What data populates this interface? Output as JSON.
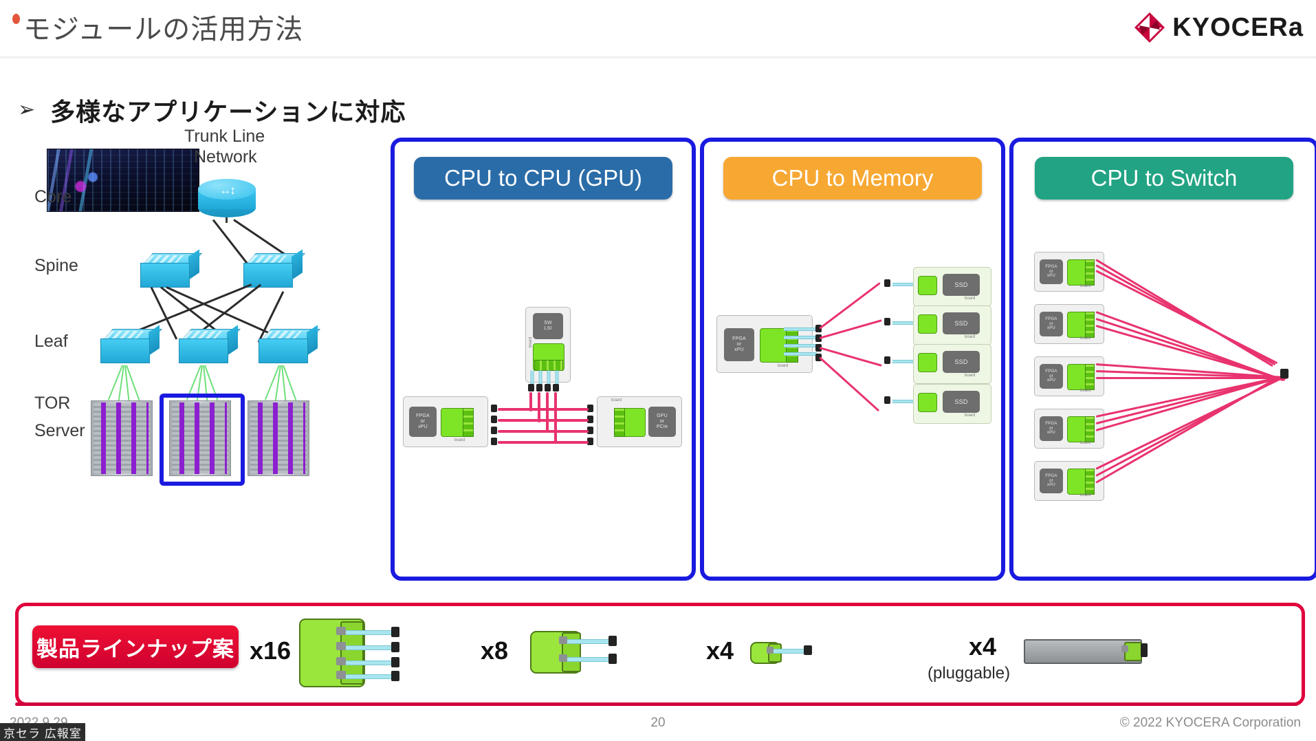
{
  "header": {
    "title": "モジュールの活用方法",
    "logo_text": "KYOCERa",
    "logo_mark_color": "#c8003c"
  },
  "bullet": {
    "marker": "➢",
    "text": "多様なアプリケーションに対応"
  },
  "network": {
    "trunk_label_line1": "Trunk Line",
    "trunk_label_line2": "Network",
    "tiers": [
      {
        "label": "Core"
      },
      {
        "label": "Spine"
      },
      {
        "label": "Leaf"
      },
      {
        "label": "TOR"
      },
      {
        "label": "Server"
      }
    ],
    "highlight_color": "#1a1ae0"
  },
  "panels": [
    {
      "id": "cpu-to-cpu",
      "title": "CPU to CPU (GPU)",
      "header_color": "#2a6ca8",
      "border_color": "#1a1ae0",
      "devices": [
        {
          "chip": "FPGA\nor\nxPU",
          "board": "board"
        },
        {
          "chip": "GPU\nor\nPCIe",
          "board": "board"
        },
        {
          "chip": "SW\nLSI",
          "board": "board"
        }
      ],
      "link_count": 4
    },
    {
      "id": "cpu-to-memory",
      "title": "CPU to Memory",
      "header_color": "#f7a833",
      "border_color": "#1a1ae0",
      "devices": [
        {
          "chip": "FPGA\nor\nxPU",
          "board": "board"
        }
      ],
      "targets": [
        {
          "chip": "SSD",
          "board": "board"
        },
        {
          "chip": "SSD",
          "board": "board"
        },
        {
          "chip": "SSD",
          "board": "board"
        },
        {
          "chip": "SSD",
          "board": "board"
        }
      ],
      "link_count": 4
    },
    {
      "id": "cpu-to-switch",
      "title": "CPU to Switch",
      "header_color": "#22a383",
      "border_color": "#1a1ae0",
      "devices": [
        {
          "chip": "FPGA\nor\nxPU",
          "board": "board"
        },
        {
          "chip": "FPGA\nor\nxPU",
          "board": "board"
        },
        {
          "chip": "FPGA\nor\nxPU",
          "board": "board"
        },
        {
          "chip": "FPGA\nor\nxPU",
          "board": "board"
        },
        {
          "chip": "FPGA\nor\nxPU",
          "board": "board"
        }
      ],
      "link_count": 5
    }
  ],
  "lineup": {
    "badge": "製品ラインナップ案",
    "border_color": "#e0003c",
    "items": [
      {
        "qty": "x16",
        "note": "",
        "fibers": 4,
        "style": "module"
      },
      {
        "qty": "x8",
        "note": "",
        "fibers": 2,
        "style": "module"
      },
      {
        "qty": "x4",
        "note": "",
        "fibers": 1,
        "style": "module-small"
      },
      {
        "qty": "x4",
        "note": "(pluggable)",
        "fibers": 0,
        "style": "pluggable"
      }
    ]
  },
  "footer": {
    "date": "2022.9.29",
    "page": "20",
    "copyright": "© 2022 KYOCERA Corporation",
    "watermark": "京セラ 広報室"
  }
}
